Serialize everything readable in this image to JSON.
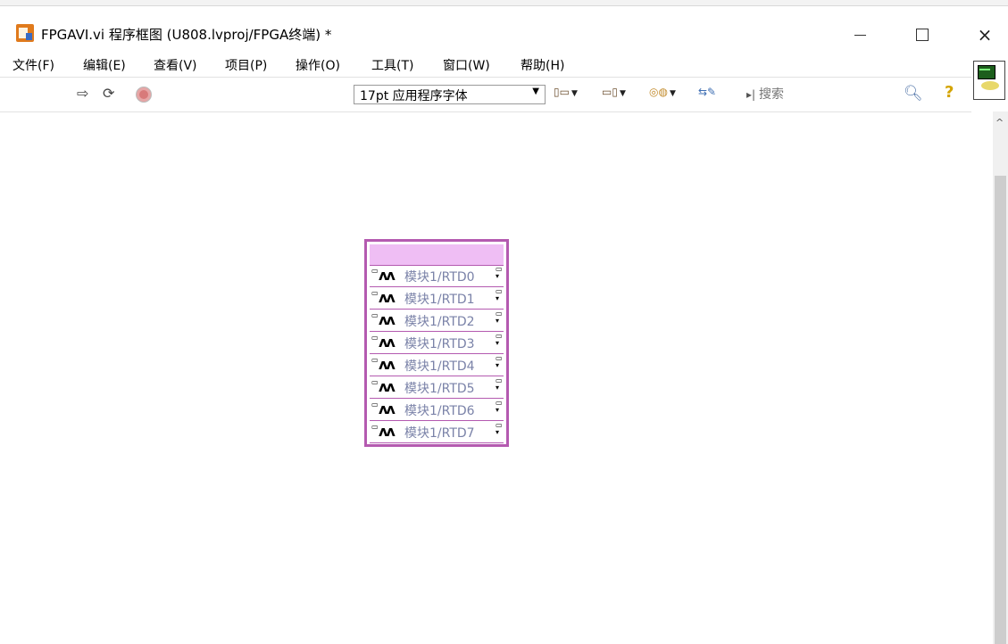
{
  "window": {
    "title": "FPGAVI.vi 程序框图 (U808.lvproj/FPGA终端) *",
    "minimize_glyph": "—",
    "close_glyph": "×"
  },
  "menu": {
    "items": [
      "文件(F)",
      "编辑(E)",
      "查看(V)",
      "项目(P)",
      "操作(O)",
      "工具(T)",
      "窗口(W)",
      "帮助(H)"
    ]
  },
  "toolbar": {
    "run_glyph": "⇨",
    "continuous_run_glyph": "⟳",
    "font_select_value": "17pt 应用程序字体",
    "search_placeholder": "搜索",
    "help_glyph": "?",
    "icons": [
      "run-arrow-icon",
      "run-continuously-icon",
      "abort-icon",
      "align-objects-icon",
      "distribute-objects-icon",
      "reorder-icon",
      "clean-up-diagram-icon",
      "search-icon",
      "help-icon"
    ]
  },
  "io_node": {
    "wave_glyph": "ʌʌ",
    "rows": [
      "模块1/RTD0",
      "模块1/RTD1",
      "模块1/RTD2",
      "模块1/RTD3",
      "模块1/RTD4",
      "模块1/RTD5",
      "模块1/RTD6",
      "模块1/RTD7"
    ]
  },
  "colors": {
    "node_border": "#b45ab0",
    "node_header": "#efbef4",
    "row_label": "#7a82a8"
  }
}
